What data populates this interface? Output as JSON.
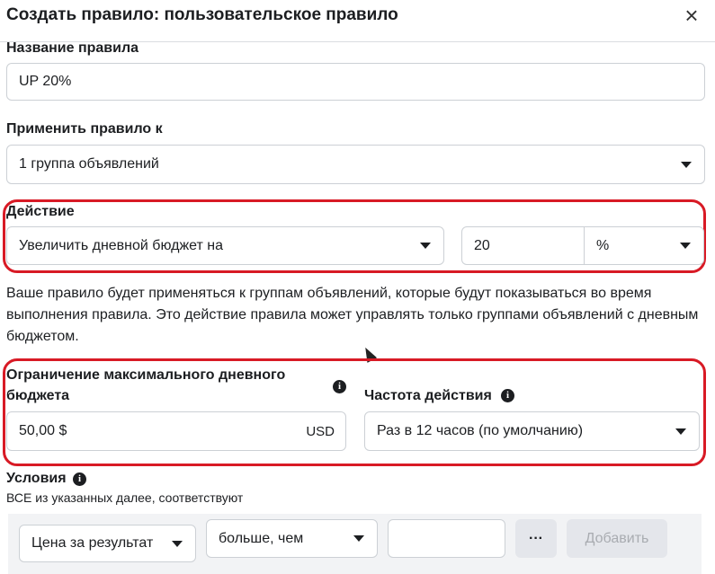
{
  "dialog": {
    "title": "Создать правило: пользовательское правило"
  },
  "rule_name": {
    "label": "Название правила",
    "value": "UP 20%"
  },
  "apply_to": {
    "label": "Применить правило к",
    "value": "1 группа объявлений"
  },
  "action": {
    "label": "Действие",
    "type_value": "Увеличить дневной бюджет на",
    "amount_value": "20",
    "unit_value": "%",
    "help_text": "Ваше правило будет применяться к группам объявлений, которые будут показываться во время выполнения правила. Это действие правила может управлять только группами объявлений с дневным бюджетом."
  },
  "max_budget": {
    "label_line1": "Ограничение максимального дневного",
    "label_line2": "бюджета",
    "value": "50,00 $",
    "currency": "USD"
  },
  "frequency": {
    "label": "Частота действия",
    "value": "Раз в 12 часов (по умолчанию)"
  },
  "conditions": {
    "label": "Условия",
    "subtitle": "ВСЕ из указанных далее, соответствуют",
    "metric_value": "Цена за результат",
    "operator_value": "больше, чем",
    "amount_value": "",
    "more_label": "···",
    "add_label": "Добавить"
  },
  "colors": {
    "highlight": "#d81a25",
    "disabled_button": "#e4e6eb"
  },
  "icons": {
    "close": "close-icon",
    "info": "info-icon",
    "dropdown": "chevron-down-icon"
  }
}
